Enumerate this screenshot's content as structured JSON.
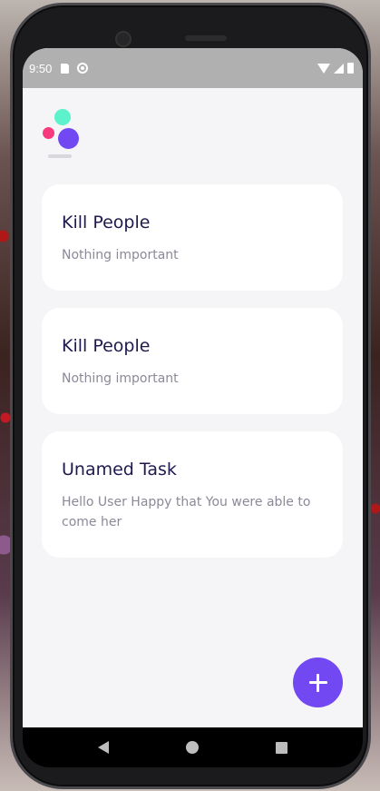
{
  "status_bar": {
    "time": "9:50"
  },
  "tasks": [
    {
      "title": "Kill People",
      "description": "Nothing important"
    },
    {
      "title": "Kill People",
      "description": "Nothing important"
    },
    {
      "title": "Unamed Task",
      "description": "Hello User Happy that You were able to come her"
    }
  ],
  "colors": {
    "accent": "#7248f2",
    "logo_teal": "#5cf2cc",
    "logo_pink": "#f73a7d",
    "title_text": "#1e1a4f",
    "desc_text": "#8a8a98",
    "screen_bg": "#f5f5f7"
  },
  "icons": {
    "fab": "plus-icon",
    "nav": [
      "back-icon",
      "home-icon",
      "recents-icon"
    ]
  }
}
